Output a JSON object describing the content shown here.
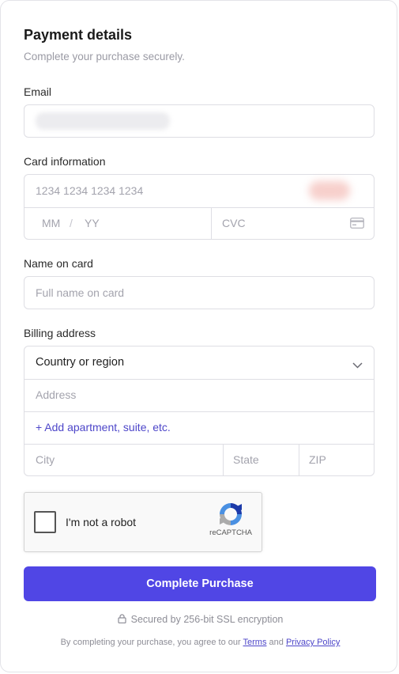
{
  "header": {
    "title": "Payment details",
    "subtitle": "Complete your purchase securely."
  },
  "email": {
    "label": "Email",
    "value_redacted": true
  },
  "card": {
    "label": "Card information",
    "number_placeholder": "1234 1234 1234 1234",
    "mm_placeholder": "MM",
    "separator": "/",
    "yy_placeholder": "YY",
    "cvc_placeholder": "CVC",
    "cvc_icon": "card-icon"
  },
  "name": {
    "label": "Name on card",
    "placeholder": "Full name on card"
  },
  "billing": {
    "label": "Billing address",
    "country_value": "Country or region",
    "country_icon": "chevron-down-icon",
    "address_placeholder": "Address",
    "add_line_link": "+ Add apartment, suite, etc.",
    "city_placeholder": "City",
    "state_placeholder": "State",
    "zip_placeholder": "ZIP"
  },
  "recaptcha": {
    "label": "I'm not a robot",
    "brand": "reCAPTCHA"
  },
  "submit": {
    "label": "Complete Purchase",
    "color": "#5046e5"
  },
  "footer": {
    "secured": "Secured by 256-bit SSL encryption",
    "agree_prefix": "By completing your purchase, you agree to our",
    "terms_link": "Terms",
    "and": "and",
    "privacy_link": "Privacy Policy"
  },
  "colors": {
    "accent": "#4d46c9",
    "border": "#dedee4",
    "muted": "#9a9aa4"
  }
}
